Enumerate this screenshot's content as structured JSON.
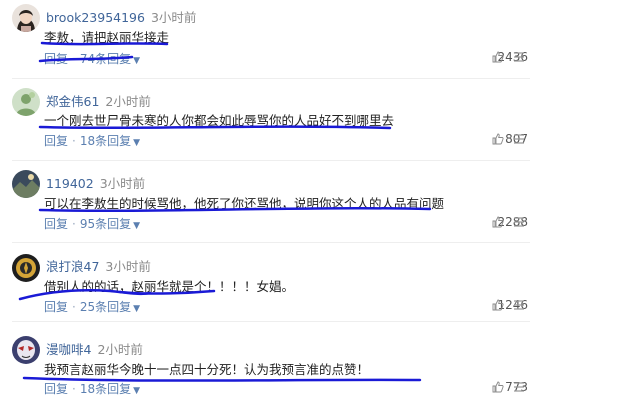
{
  "comments": [
    {
      "username": "brook23954196",
      "time": "3小时前",
      "text": "李敖，请把赵丽华接走",
      "reply_label": "回复",
      "replies_label": "74条回复",
      "likes": "2436"
    },
    {
      "username": "郑金伟61",
      "time": "2小时前",
      "text": "一个刚去世尸骨未寒的人你都会如此辱骂你的人品好不到哪里去",
      "reply_label": "回复",
      "replies_label": "18条回复",
      "likes": "807"
    },
    {
      "username": "119402",
      "time": "3小时前",
      "text": "可以在李敖生的时候骂他，他死了你还骂他，说明你这个人的人品有问题",
      "reply_label": "回复",
      "replies_label": "95条回复",
      "likes": "2288"
    },
    {
      "username": "浪打浪47",
      "time": "3小时前",
      "text": "借别人的的话，赵丽华就是个！！！！女娼。",
      "reply_label": "回复",
      "replies_label": "25条回复",
      "likes": "1246"
    },
    {
      "username": "漫咖啡4",
      "time": "2小时前",
      "text": "我预言赵丽华今晚十一点四十分死！认为我预言准的点赞！",
      "reply_label": "回复",
      "replies_label": "18条回复",
      "likes": "773"
    }
  ],
  "icons": {
    "like": "thumbs-up-icon",
    "more": "more-options-icon",
    "chevron": "chevron-down-icon"
  },
  "colors": {
    "username": "#406599",
    "link": "#5b7fb0",
    "underline": "#1a1ad6"
  }
}
